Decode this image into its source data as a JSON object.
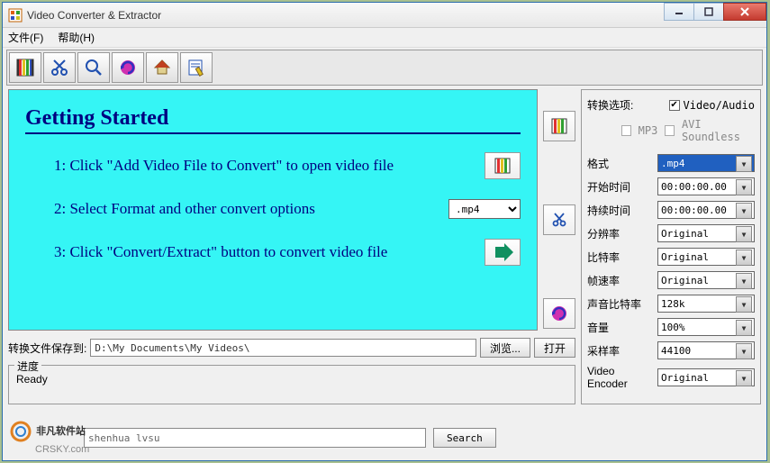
{
  "window": {
    "title": "Video Converter & Extractor"
  },
  "menu": {
    "file": "文件(F)",
    "help": "帮助(H)"
  },
  "toolbar_icons": [
    "film-icon",
    "scissors-icon",
    "magnifier-icon",
    "refresh-icon",
    "home-icon",
    "edit-icon"
  ],
  "getting_started": {
    "title": "Getting Started",
    "step1": "1: Click \"Add Video File to Convert\" to open video file",
    "step2": "2: Select Format and other convert options",
    "step2_value": ".mp4",
    "step3": "3: Click \"Convert/Extract\" button to convert video file"
  },
  "side_icons": [
    "film-icon",
    "scissors-icon",
    "refresh-icon"
  ],
  "output": {
    "label": "转换文件保存到:",
    "path": "D:\\My Documents\\My Videos\\",
    "browse": "浏览...",
    "open": "打开"
  },
  "progress": {
    "label": "进度",
    "status": "Ready"
  },
  "options": {
    "header": "转换选项:",
    "video_audio": "Video/Audio",
    "mp3": "MP3",
    "avi_soundless": "AVI Soundless",
    "rows": [
      {
        "label": "格式",
        "value": ".mp4",
        "blue": true
      },
      {
        "label": "开始时间",
        "value": "00:00:00.00"
      },
      {
        "label": "持续时间",
        "value": "00:00:00.00"
      },
      {
        "label": "分辨率",
        "value": "Original"
      },
      {
        "label": "比特率",
        "value": "Original"
      },
      {
        "label": "帧速率",
        "value": "Original"
      },
      {
        "label": "声音比特率",
        "value": "128k"
      },
      {
        "label": "音量",
        "value": "100%"
      },
      {
        "label": "采样率",
        "value": "44100"
      },
      {
        "label": "Video Encoder",
        "value": "Original"
      }
    ]
  },
  "search": {
    "value": "shenhua lvsu",
    "button": "Search"
  },
  "watermark": {
    "brand": "非凡软件站",
    "site": "CRSKY.com"
  }
}
